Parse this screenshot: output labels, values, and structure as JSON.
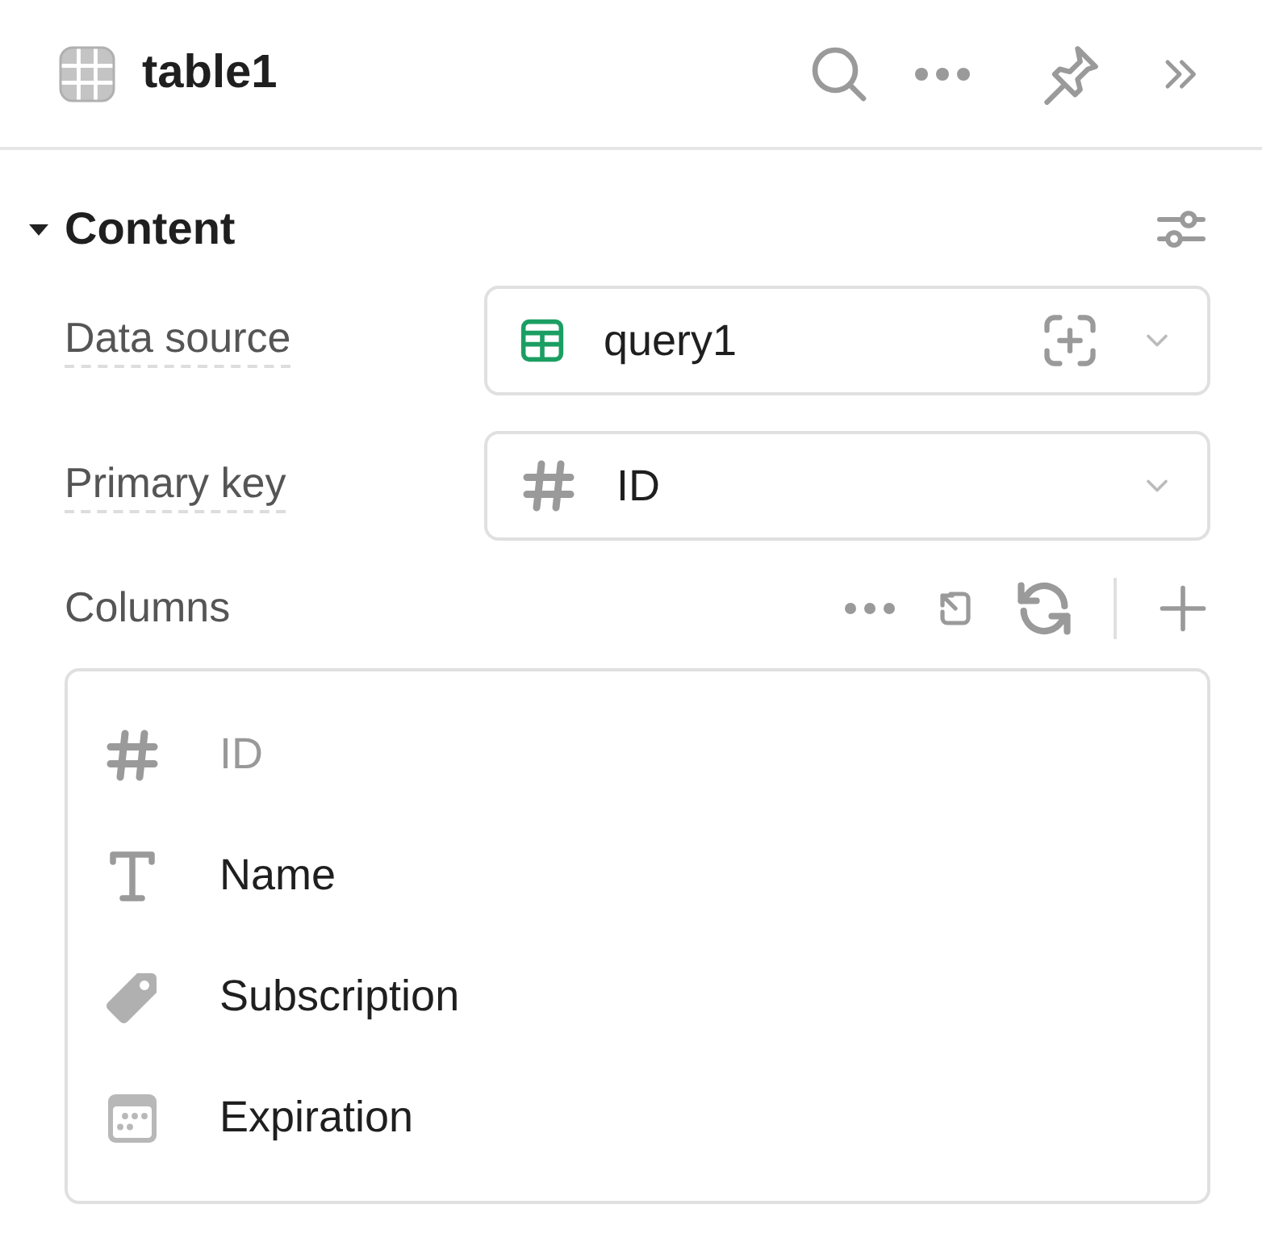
{
  "header": {
    "title": "table1"
  },
  "section": {
    "title": "Content",
    "expanded": true
  },
  "fields": [
    {
      "label": "Data source",
      "value": "query1",
      "kind": "query"
    },
    {
      "label": "Primary key",
      "value": "ID",
      "kind": "number"
    }
  ],
  "columns": {
    "label": "Columns",
    "items": [
      {
        "name": "ID",
        "kind": "number",
        "disabled": true
      },
      {
        "name": "Name",
        "kind": "text",
        "disabled": false
      },
      {
        "name": "Subscription",
        "kind": "tag",
        "disabled": false
      },
      {
        "name": "Expiration",
        "kind": "date",
        "disabled": false
      }
    ]
  }
}
